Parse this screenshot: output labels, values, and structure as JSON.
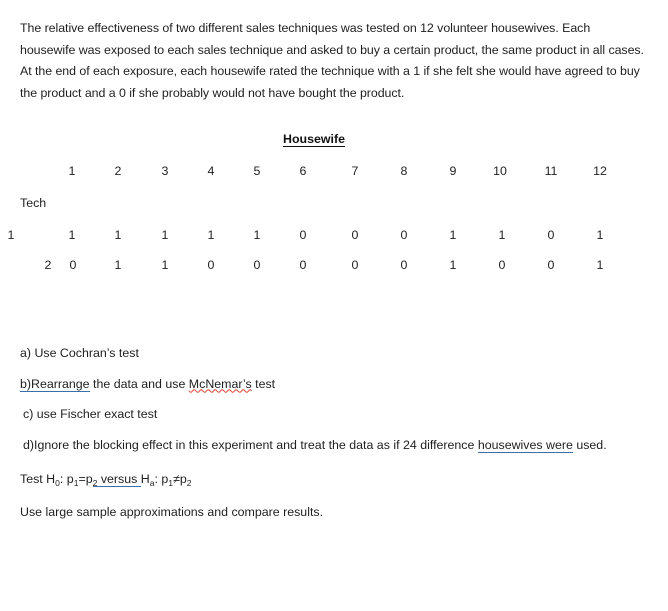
{
  "document": {
    "intro": "The relative effectiveness of two different sales techniques was tested on 12 volunteer housewives. Each housewife was exposed to each sales technique and asked to buy a certain product, the same product in all cases.  At the end of each exposure, each housewife rated the technique with a 1 if she felt she would have agreed to buy the product and a 0 if she probably would not have bought the product."
  },
  "table": {
    "title": "Housewife",
    "row_group_label": "Tech",
    "column_headers": [
      "1",
      "2",
      "3",
      "4",
      "5",
      "6",
      "7",
      "8",
      "9",
      "10",
      "11",
      "12"
    ],
    "rows": [
      {
        "label": "1",
        "values": [
          "1",
          "1",
          "1",
          "1",
          "1",
          "0",
          "0",
          "0",
          "1",
          "1",
          "0",
          "1"
        ]
      },
      {
        "label": "2",
        "values": [
          "0",
          "1",
          "1",
          "0",
          "0",
          "0",
          "0",
          "0",
          "1",
          "0",
          "0",
          "1"
        ]
      }
    ]
  },
  "questions": {
    "a": {
      "full": "a) Use Cochran’s test"
    },
    "b": {
      "marked": "b)Rearrange",
      "middle": " the data and use ",
      "misspelled": "McNemar’s",
      "tail": " test"
    },
    "c": {
      "full": "c) use Fischer exact test"
    },
    "d": {
      "head": "d)Ignore the blocking effect in this experiment and treat the data as if 24 difference ",
      "marked": "housewives  were",
      "tail": " used."
    },
    "hypothesis": {
      "lead": "Test H",
      "null_sub": "0",
      "mid1": ":  p",
      "p1_sub": "1",
      "eq": "=p",
      "p2_sub": "2",
      "versus": " versus ",
      "alt": "H",
      "alt_sub": "a",
      "mid2": ":  p",
      "p3_sub": "1",
      "neq": "≠p",
      "p4_sub": "2"
    },
    "closing": "Use large sample approximations and compare results."
  },
  "colors": {
    "text": "#1f1f1f",
    "grammar_underline": "#3a6fa8",
    "spelling_underline": "#d9432f",
    "background": "#ffffff"
  }
}
